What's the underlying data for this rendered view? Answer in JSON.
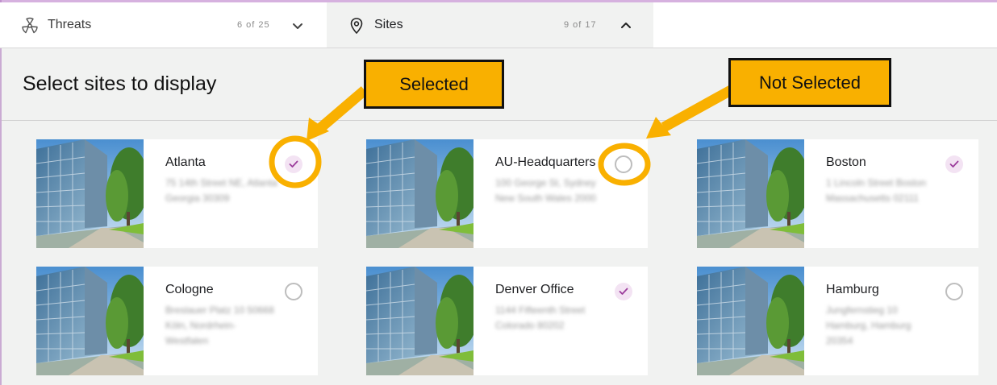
{
  "tabs": [
    {
      "label": "Threats",
      "count": "6 of 25",
      "icon": "radiation-icon",
      "chevron": "chevron-down-icon"
    },
    {
      "label": "Sites",
      "count": "9 of 17",
      "icon": "location-pin-icon",
      "chevron": "chevron-up-icon"
    }
  ],
  "panel": {
    "title": "Select sites to display"
  },
  "sites": [
    {
      "name": "Atlanta",
      "address": "75 14th Street NE, Atlanta Georgia 30309",
      "selected": true
    },
    {
      "name": "AU-Headquarters",
      "address": "100 George St, Sydney New South Wales 2000",
      "selected": false
    },
    {
      "name": "Boston",
      "address": "1 Lincoln Street Boston Massachusetts 02111",
      "selected": true
    },
    {
      "name": "Cologne",
      "address": "Breslauer Platz 10 50668 Köln, Nordrhein-Westfalen",
      "selected": false
    },
    {
      "name": "Denver Office",
      "address": "1144 Fifteenth Street Colorado 80202",
      "selected": true
    },
    {
      "name": "Hamburg",
      "address": "Jungfernstieg 10 Hamburg, Hamburg 20354",
      "selected": false
    }
  ],
  "annotations": {
    "selected_label": "Selected",
    "not_selected_label": "Not Selected",
    "highlight_color": "#f9b000"
  },
  "colors": {
    "accent": "#9c3d9c",
    "checked_bg": "#f3e3f3",
    "unchecked_border": "#bdbdbd"
  }
}
